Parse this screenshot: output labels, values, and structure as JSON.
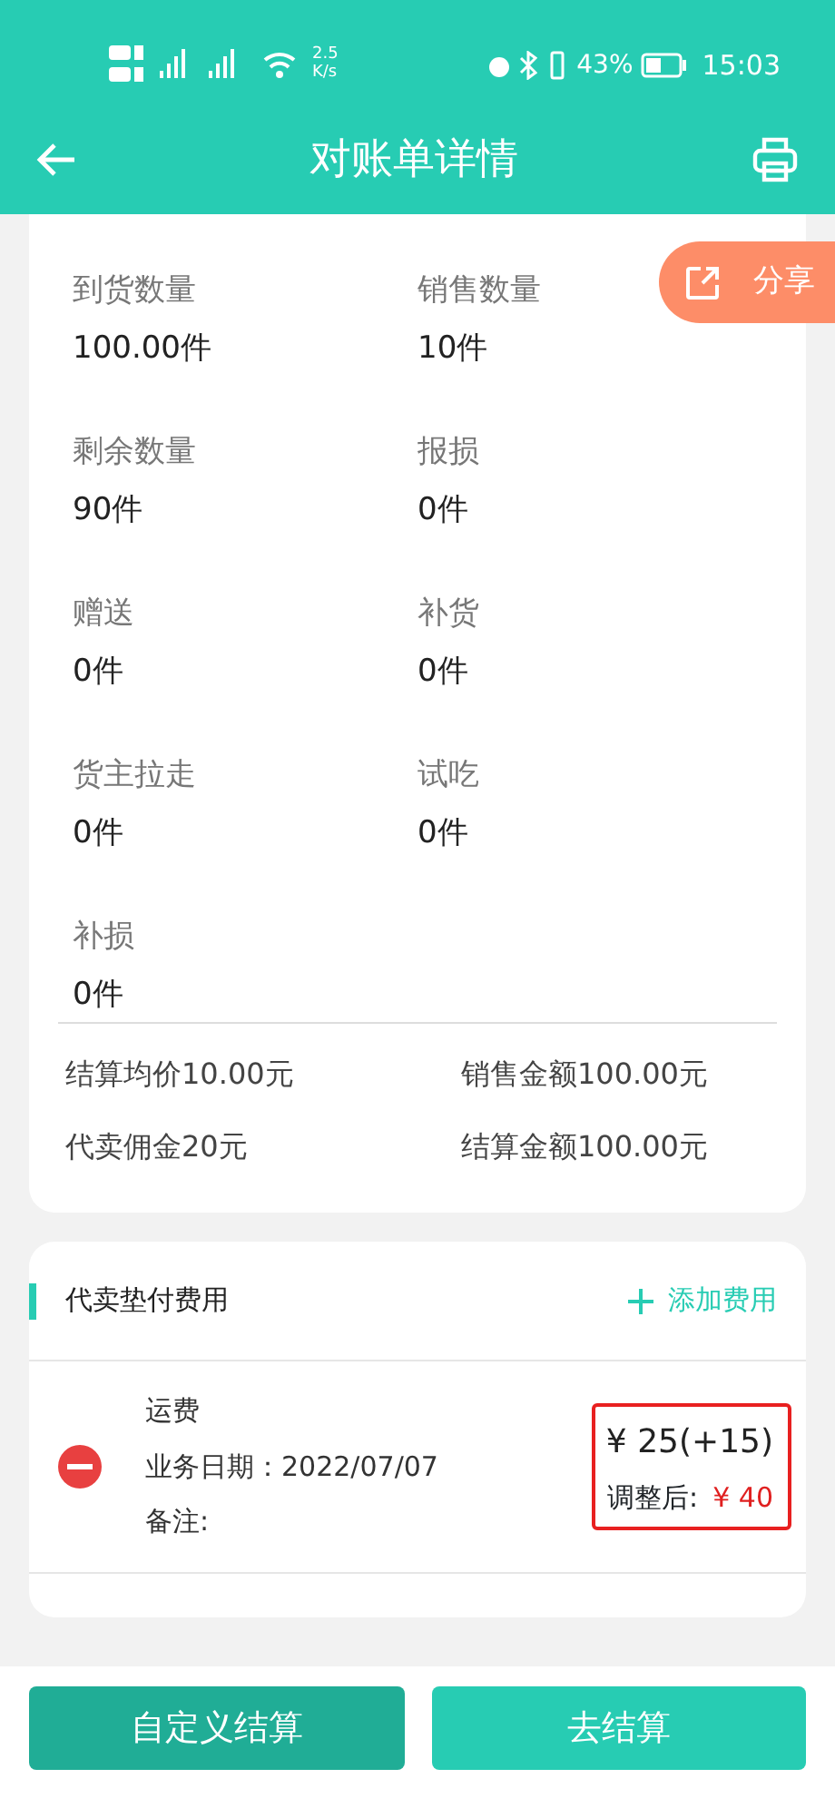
{
  "status_bar": {
    "speed_value": "2.5",
    "speed_unit": "K/s",
    "battery": "43%",
    "time": "15:03"
  },
  "header": {
    "title": "对账单详情"
  },
  "share_button": {
    "label": "分享"
  },
  "stats": [
    {
      "label": "到货数量",
      "value": "100.00件"
    },
    {
      "label": "销售数量",
      "value": "10件"
    },
    {
      "label": "剩余数量",
      "value": "90件"
    },
    {
      "label": "报损",
      "value": "0件"
    },
    {
      "label": "赠送",
      "value": "0件"
    },
    {
      "label": "补货",
      "value": "0件"
    },
    {
      "label": "货主拉走",
      "value": "0件"
    },
    {
      "label": "试吃",
      "value": "0件"
    },
    {
      "label": "补损",
      "value": "0件"
    }
  ],
  "summary": [
    "结算均价10.00元",
    "销售金额100.00元",
    "代卖佣金20元",
    "结算金额100.00元"
  ],
  "fees": {
    "title": "代卖垫付费用",
    "add_button": "添加费用",
    "items": [
      {
        "name": "运费",
        "date": "业务日期：2022/07/07",
        "note": "备注:",
        "amount": "¥ 25(+15)",
        "adjusted_label": "调整后:",
        "adjusted_value": "¥ 40"
      }
    ]
  },
  "buttons": [
    {
      "label": "自定义结算",
      "kind": "secondary"
    },
    {
      "label": "去结算",
      "kind": "primary"
    }
  ]
}
